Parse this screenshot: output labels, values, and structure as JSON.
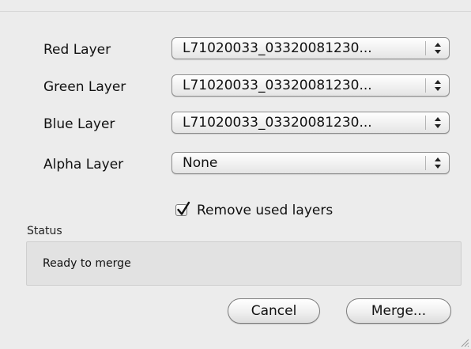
{
  "layers": [
    {
      "label": "Red Layer",
      "value": "L71020033_03320081230..."
    },
    {
      "label": "Green Layer",
      "value": "L71020033_03320081230..."
    },
    {
      "label": "Blue Layer",
      "value": "L71020033_03320081230..."
    },
    {
      "label": "Alpha Layer",
      "value": "None"
    }
  ],
  "remove_used_layers": {
    "label": "Remove used layers",
    "checked": true
  },
  "status": {
    "caption": "Status",
    "text": "Ready to merge"
  },
  "buttons": {
    "cancel": "Cancel",
    "merge": "Merge..."
  },
  "icons": {
    "popup_arrows": "up-down-arrows-icon",
    "checkmark": "checkmark-icon",
    "resize_grip": "resize-grip-icon"
  }
}
